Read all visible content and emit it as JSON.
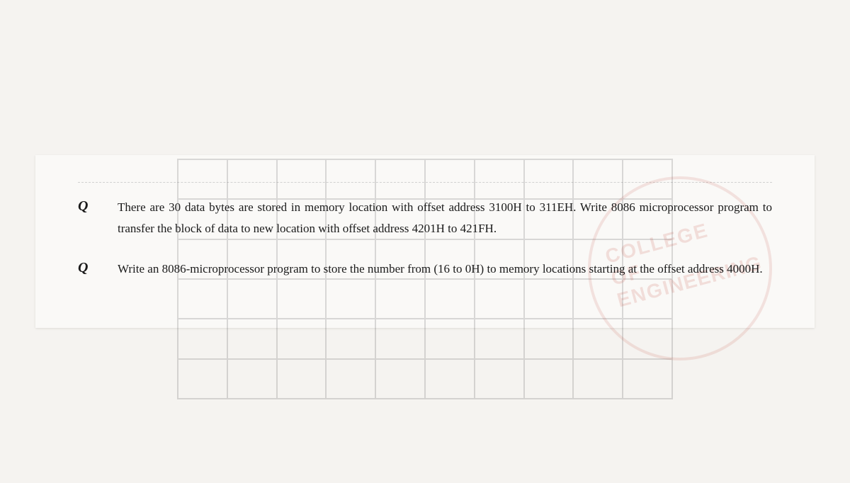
{
  "document": {
    "background_color": "#f5f3f0",
    "questions": [
      {
        "id": "q1",
        "label": "Q",
        "text": "There are 30 data bytes are stored in memory location with offset address 3100H to 311EH. Write 8086 microprocessor program to transfer the block of data to new location with offset address 4201H to 421FH."
      },
      {
        "id": "q2",
        "label": "Q",
        "text": "Write an 8086-microprocessor program to store the number from (16 to 0H) to memory locations starting at the offset address 4000H."
      }
    ],
    "stamp": {
      "line1": "COLLEGE OF",
      "line2": "ENGINEERING"
    }
  }
}
